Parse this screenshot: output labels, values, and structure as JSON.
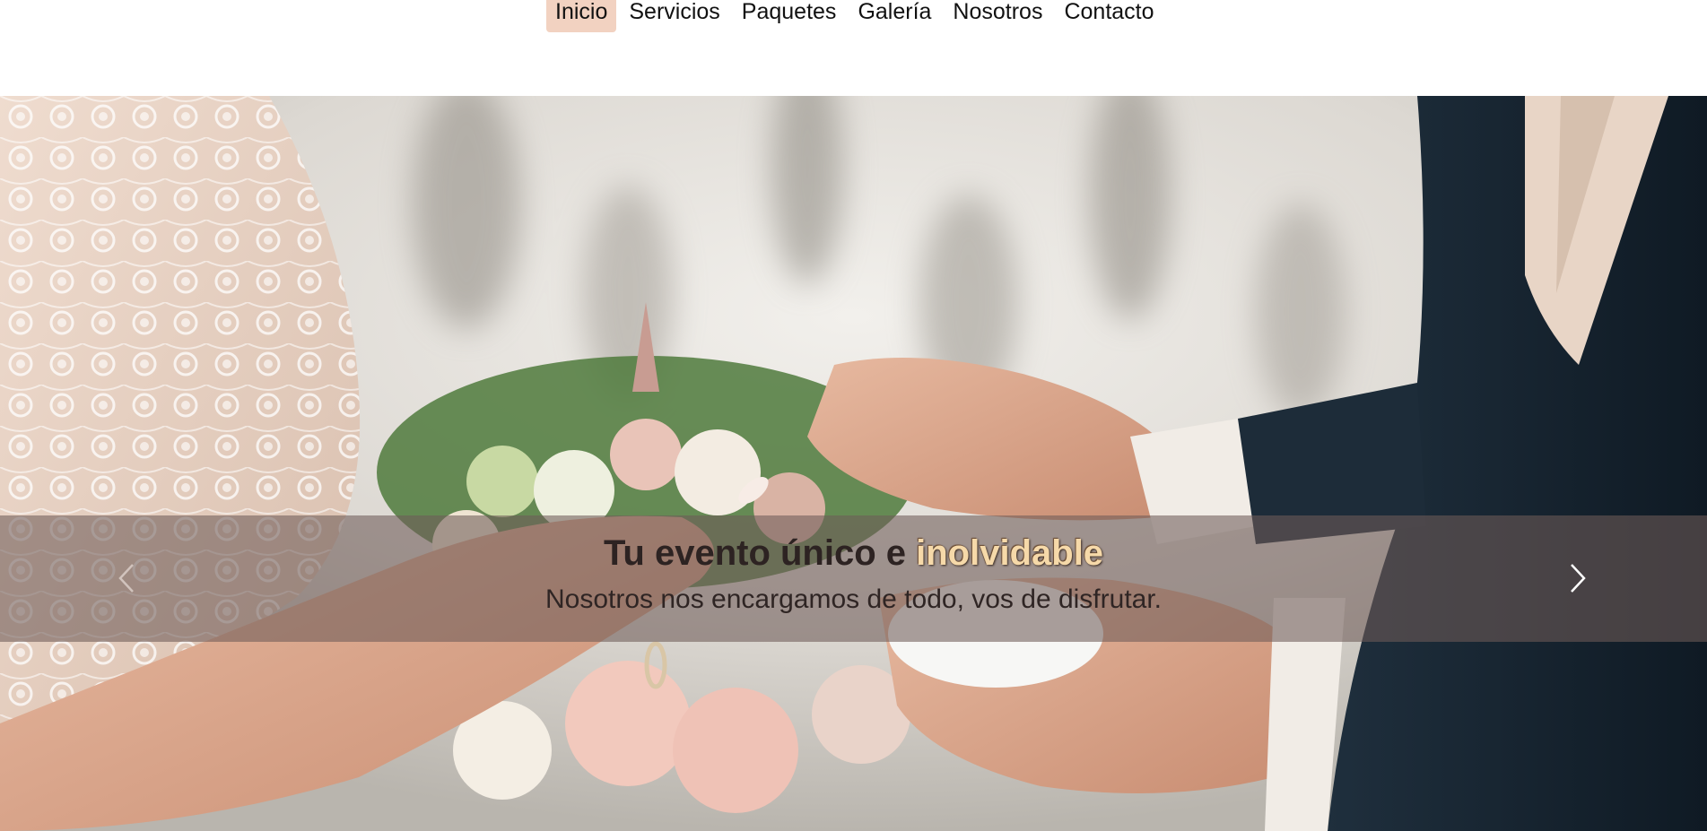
{
  "nav": {
    "items": [
      {
        "label": "Inicio",
        "active": true
      },
      {
        "label": "Servicios",
        "active": false
      },
      {
        "label": "Paquetes",
        "active": false
      },
      {
        "label": "Galería",
        "active": false
      },
      {
        "label": "Nosotros",
        "active": false
      },
      {
        "label": "Contacto",
        "active": false
      }
    ]
  },
  "hero": {
    "title_prefix": "Tu evento único e ",
    "title_highlight": "inolvidable",
    "subtitle": "Nosotros nos encargamos de todo, vos de disfrutar.",
    "prev_icon": "chevron-left-icon",
    "next_icon": "chevron-right-icon"
  },
  "colors": {
    "active_nav_bg": "#f2d2c1",
    "caption_band": "rgba(110, 92, 88, 0.58)",
    "highlight_text": "#f6d9a9"
  }
}
